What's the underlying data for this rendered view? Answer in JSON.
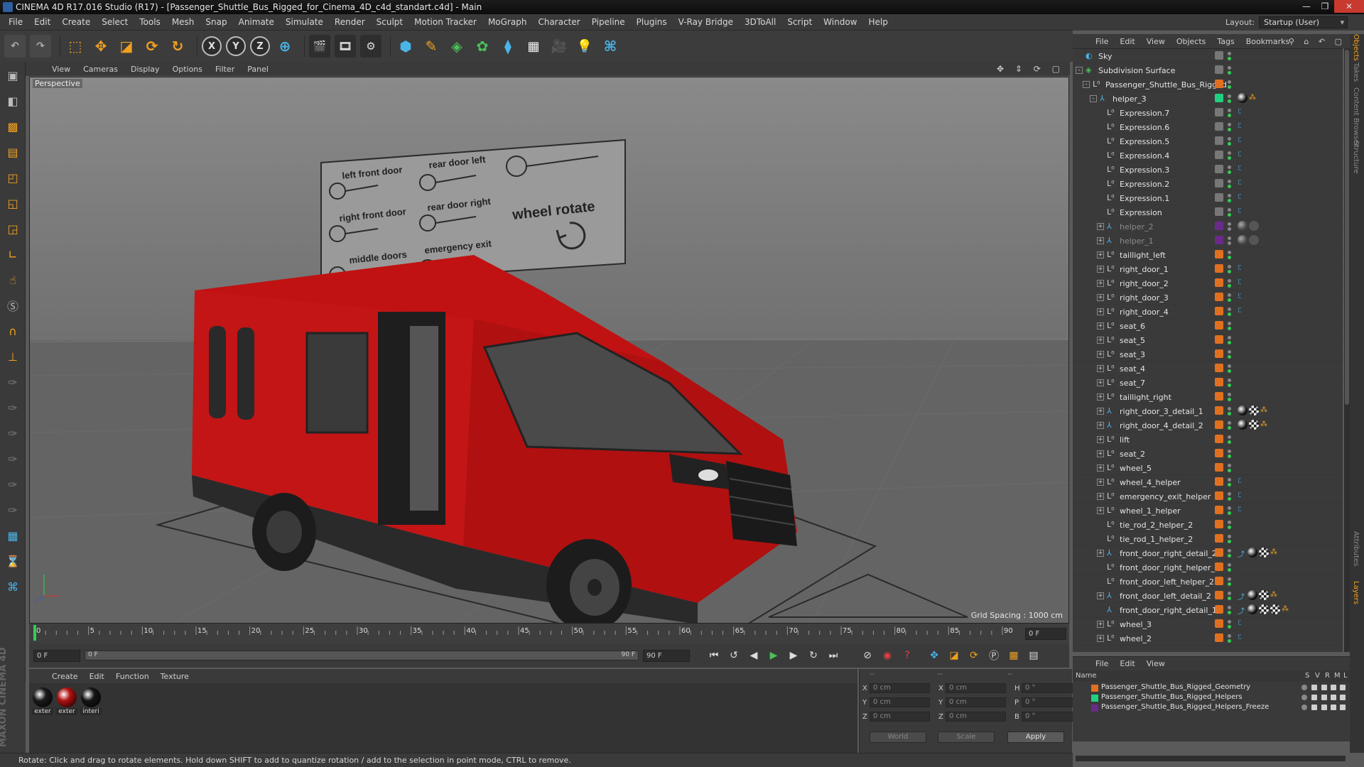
{
  "window": {
    "title": "CINEMA 4D R17.016 Studio (R17) - [Passenger_Shuttle_Bus_Rigged_for_Cinema_4D_c4d_standart.c4d] - Main"
  },
  "menubar": [
    "File",
    "Edit",
    "Create",
    "Select",
    "Tools",
    "Mesh",
    "Snap",
    "Animate",
    "Simulate",
    "Render",
    "Sculpt",
    "Motion Tracker",
    "MoGraph",
    "Character",
    "Pipeline",
    "Plugins",
    "V-Ray Bridge",
    "3DToAll",
    "Script",
    "Window",
    "Help"
  ],
  "layout": {
    "label": "Layout:",
    "value": "Startup (User)"
  },
  "toolbar": {
    "axis_x": "X",
    "axis_y": "Y",
    "axis_z": "Z"
  },
  "viewport": {
    "menu": [
      "View",
      "Cameras",
      "Display",
      "Options",
      "Filter",
      "Panel"
    ],
    "label": "Perspective",
    "grid_spacing": "Grid Spacing : 1000 cm",
    "board_labels": {
      "left_front_door": "left front door",
      "rear_door_left": "rear door left",
      "right_front_door": "right front door",
      "rear_door_right": "rear door right",
      "wheel_rotate": "wheel rotate",
      "middle_doors": "middle doors",
      "emergency_exit": "emergency exit"
    }
  },
  "timeline": {
    "ticks": [
      "0",
      "5",
      "10",
      "15",
      "20",
      "25",
      "30",
      "35",
      "40",
      "45",
      "50",
      "55",
      "60",
      "65",
      "70",
      "75",
      "80",
      "85",
      "90"
    ],
    "current_frame": "0 F",
    "start_field": "0 F",
    "range_start": "0 F",
    "range_end": "90 F",
    "end_field": "90 F"
  },
  "materials": {
    "menu": [
      "Create",
      "Edit",
      "Function",
      "Texture"
    ],
    "items": [
      {
        "label": "exter",
        "color": "#1a1a1a"
      },
      {
        "label": "exter",
        "color": "#b01010"
      },
      {
        "label": "interi",
        "color": "#151515"
      }
    ]
  },
  "coords": {
    "header": [
      "--",
      "--",
      "--"
    ],
    "rows": [
      {
        "a": "X",
        "av": "0 cm",
        "b": "X",
        "bv": "0 cm",
        "c": "H",
        "cv": "0 °"
      },
      {
        "a": "Y",
        "av": "0 cm",
        "b": "Y",
        "bv": "0 cm",
        "c": "P",
        "cv": "0 °"
      },
      {
        "a": "Z",
        "av": "0 cm",
        "b": "Z",
        "bv": "0 cm",
        "c": "B",
        "cv": "0 °"
      }
    ],
    "world": "World",
    "scale": "Scale",
    "apply": "Apply"
  },
  "status": "Rotate: Click and drag to rotate elements. Hold down SHIFT to add to quantize rotation / add to the selection in point mode, CTRL to remove.",
  "objects": {
    "menu": [
      "File",
      "Edit",
      "View",
      "Objects",
      "Tags",
      "Bookmarks"
    ],
    "rows": [
      {
        "name": "Sky",
        "indent": 0,
        "icon": "sky",
        "exp": "",
        "color": "#777777",
        "dim": false,
        "tags": ""
      },
      {
        "name": "Subdivision Surface",
        "indent": 0,
        "icon": "subd",
        "exp": "-",
        "color": "#777777",
        "dim": false,
        "tags": ""
      },
      {
        "name": "Passenger_Shuttle_Bus_Rigged",
        "indent": 1,
        "icon": "null",
        "exp": "-",
        "color": "#e07020",
        "dim": false,
        "tags": ""
      },
      {
        "name": "helper_3",
        "indent": 2,
        "icon": "joint",
        "exp": "-",
        "color": "#20d080",
        "dim": false,
        "tags": "mat"
      },
      {
        "name": "Expression.7",
        "indent": 3,
        "icon": "null",
        "exp": "",
        "color": "#777777",
        "dim": false,
        "tags": "xp"
      },
      {
        "name": "Expression.6",
        "indent": 3,
        "icon": "null",
        "exp": "",
        "color": "#777777",
        "dim": false,
        "tags": "xp"
      },
      {
        "name": "Expression.5",
        "indent": 3,
        "icon": "null",
        "exp": "",
        "color": "#777777",
        "dim": false,
        "tags": "xp"
      },
      {
        "name": "Expression.4",
        "indent": 3,
        "icon": "null",
        "exp": "",
        "color": "#777777",
        "dim": false,
        "tags": "xp"
      },
      {
        "name": "Expression.3",
        "indent": 3,
        "icon": "null",
        "exp": "",
        "color": "#777777",
        "dim": false,
        "tags": "xp"
      },
      {
        "name": "Expression.2",
        "indent": 3,
        "icon": "null",
        "exp": "",
        "color": "#777777",
        "dim": false,
        "tags": "xp"
      },
      {
        "name": "Expression.1",
        "indent": 3,
        "icon": "null",
        "exp": "",
        "color": "#777777",
        "dim": false,
        "tags": "xp"
      },
      {
        "name": "Expression",
        "indent": 3,
        "icon": "null",
        "exp": "",
        "color": "#777777",
        "dim": false,
        "tags": "xp"
      },
      {
        "name": "helper_2",
        "indent": 3,
        "icon": "joint",
        "exp": "+",
        "color": "#6a2a8a",
        "dim": true,
        "tags": "matdim"
      },
      {
        "name": "helper_1",
        "indent": 3,
        "icon": "joint",
        "exp": "+",
        "color": "#6a2a8a",
        "dim": true,
        "tags": "matdim"
      },
      {
        "name": "taillight_left",
        "indent": 3,
        "icon": "null",
        "exp": "+",
        "color": "#e07020",
        "dim": false,
        "tags": ""
      },
      {
        "name": "right_door_1",
        "indent": 3,
        "icon": "null",
        "exp": "+",
        "color": "#e07020",
        "dim": false,
        "tags": "xp"
      },
      {
        "name": "right_door_2",
        "indent": 3,
        "icon": "null",
        "exp": "+",
        "color": "#e07020",
        "dim": false,
        "tags": "xp"
      },
      {
        "name": "right_door_3",
        "indent": 3,
        "icon": "null",
        "exp": "+",
        "color": "#e07020",
        "dim": false,
        "tags": "xp"
      },
      {
        "name": "right_door_4",
        "indent": 3,
        "icon": "null",
        "exp": "+",
        "color": "#e07020",
        "dim": false,
        "tags": "xp"
      },
      {
        "name": "seat_6",
        "indent": 3,
        "icon": "null",
        "exp": "+",
        "color": "#e07020",
        "dim": false,
        "tags": ""
      },
      {
        "name": "seat_5",
        "indent": 3,
        "icon": "null",
        "exp": "+",
        "color": "#e07020",
        "dim": false,
        "tags": ""
      },
      {
        "name": "seat_3",
        "indent": 3,
        "icon": "null",
        "exp": "+",
        "color": "#e07020",
        "dim": false,
        "tags": ""
      },
      {
        "name": "seat_4",
        "indent": 3,
        "icon": "null",
        "exp": "+",
        "color": "#e07020",
        "dim": false,
        "tags": ""
      },
      {
        "name": "seat_7",
        "indent": 3,
        "icon": "null",
        "exp": "+",
        "color": "#e07020",
        "dim": false,
        "tags": ""
      },
      {
        "name": "taillight_right",
        "indent": 3,
        "icon": "null",
        "exp": "+",
        "color": "#e07020",
        "dim": false,
        "tags": ""
      },
      {
        "name": "right_door_3_detail_1",
        "indent": 3,
        "icon": "joint",
        "exp": "+",
        "color": "#e07020",
        "dim": false,
        "tags": "mat3"
      },
      {
        "name": "right_door_4_detail_2",
        "indent": 3,
        "icon": "joint",
        "exp": "+",
        "color": "#e07020",
        "dim": false,
        "tags": "mat3"
      },
      {
        "name": "lift",
        "indent": 3,
        "icon": "null",
        "exp": "+",
        "color": "#e07020",
        "dim": false,
        "tags": ""
      },
      {
        "name": "seat_2",
        "indent": 3,
        "icon": "null",
        "exp": "+",
        "color": "#e07020",
        "dim": false,
        "tags": ""
      },
      {
        "name": "wheel_5",
        "indent": 3,
        "icon": "null",
        "exp": "+",
        "color": "#e07020",
        "dim": false,
        "tags": ""
      },
      {
        "name": "wheel_4_helper",
        "indent": 3,
        "icon": "null",
        "exp": "+",
        "color": "#e07020",
        "dim": false,
        "tags": "xp"
      },
      {
        "name": "emergency_exit_helper",
        "indent": 3,
        "icon": "null",
        "exp": "+",
        "color": "#e07020",
        "dim": false,
        "tags": "xp"
      },
      {
        "name": "wheel_1_helper",
        "indent": 3,
        "icon": "null",
        "exp": "+",
        "color": "#e07020",
        "dim": false,
        "tags": "xp"
      },
      {
        "name": "tie_rod_2_helper_2",
        "indent": 3,
        "icon": "null",
        "exp": "",
        "color": "#e07020",
        "dim": false,
        "tags": ""
      },
      {
        "name": "tie_rod_1_helper_2",
        "indent": 3,
        "icon": "null",
        "exp": "",
        "color": "#e07020",
        "dim": false,
        "tags": ""
      },
      {
        "name": "front_door_right_detail_2",
        "indent": 3,
        "icon": "joint",
        "exp": "+",
        "color": "#e07020",
        "dim": false,
        "tags": "mat4"
      },
      {
        "name": "front_door_right_helper_1",
        "indent": 3,
        "icon": "null",
        "exp": "",
        "color": "#e07020",
        "dim": false,
        "tags": ""
      },
      {
        "name": "front_door_left_helper_2",
        "indent": 3,
        "icon": "null",
        "exp": "",
        "color": "#e07020",
        "dim": false,
        "tags": ""
      },
      {
        "name": "front_door_left_detail_2",
        "indent": 3,
        "icon": "joint",
        "exp": "+",
        "color": "#e07020",
        "dim": false,
        "tags": "mat4"
      },
      {
        "name": "front_door_right_detail_1",
        "indent": 3,
        "icon": "joint",
        "exp": "",
        "color": "#e07020",
        "dim": false,
        "tags": "mat5"
      },
      {
        "name": "wheel_3",
        "indent": 3,
        "icon": "null",
        "exp": "+",
        "color": "#e07020",
        "dim": false,
        "tags": "xp"
      },
      {
        "name": "wheel_2",
        "indent": 3,
        "icon": "null",
        "exp": "+",
        "color": "#e07020",
        "dim": false,
        "tags": "xp"
      }
    ]
  },
  "layers": {
    "menu": [
      "File",
      "Edit",
      "View"
    ],
    "header": {
      "name": "Name",
      "s": "S",
      "v": "V",
      "r": "R",
      "m": "M",
      "l": "L"
    },
    "rows": [
      {
        "name": "Passenger_Shuttle_Bus_Rigged_Geometry",
        "color": "#e07020"
      },
      {
        "name": "Passenger_Shuttle_Bus_Rigged_Helpers",
        "color": "#20d080"
      },
      {
        "name": "Passenger_Shuttle_Bus_Rigged_Helpers_Freeze",
        "color": "#6a2a8a"
      }
    ]
  },
  "side_tabs": [
    "Objects",
    "Takes",
    "Content Browser",
    "Structure",
    "Attributes",
    "Layers"
  ]
}
